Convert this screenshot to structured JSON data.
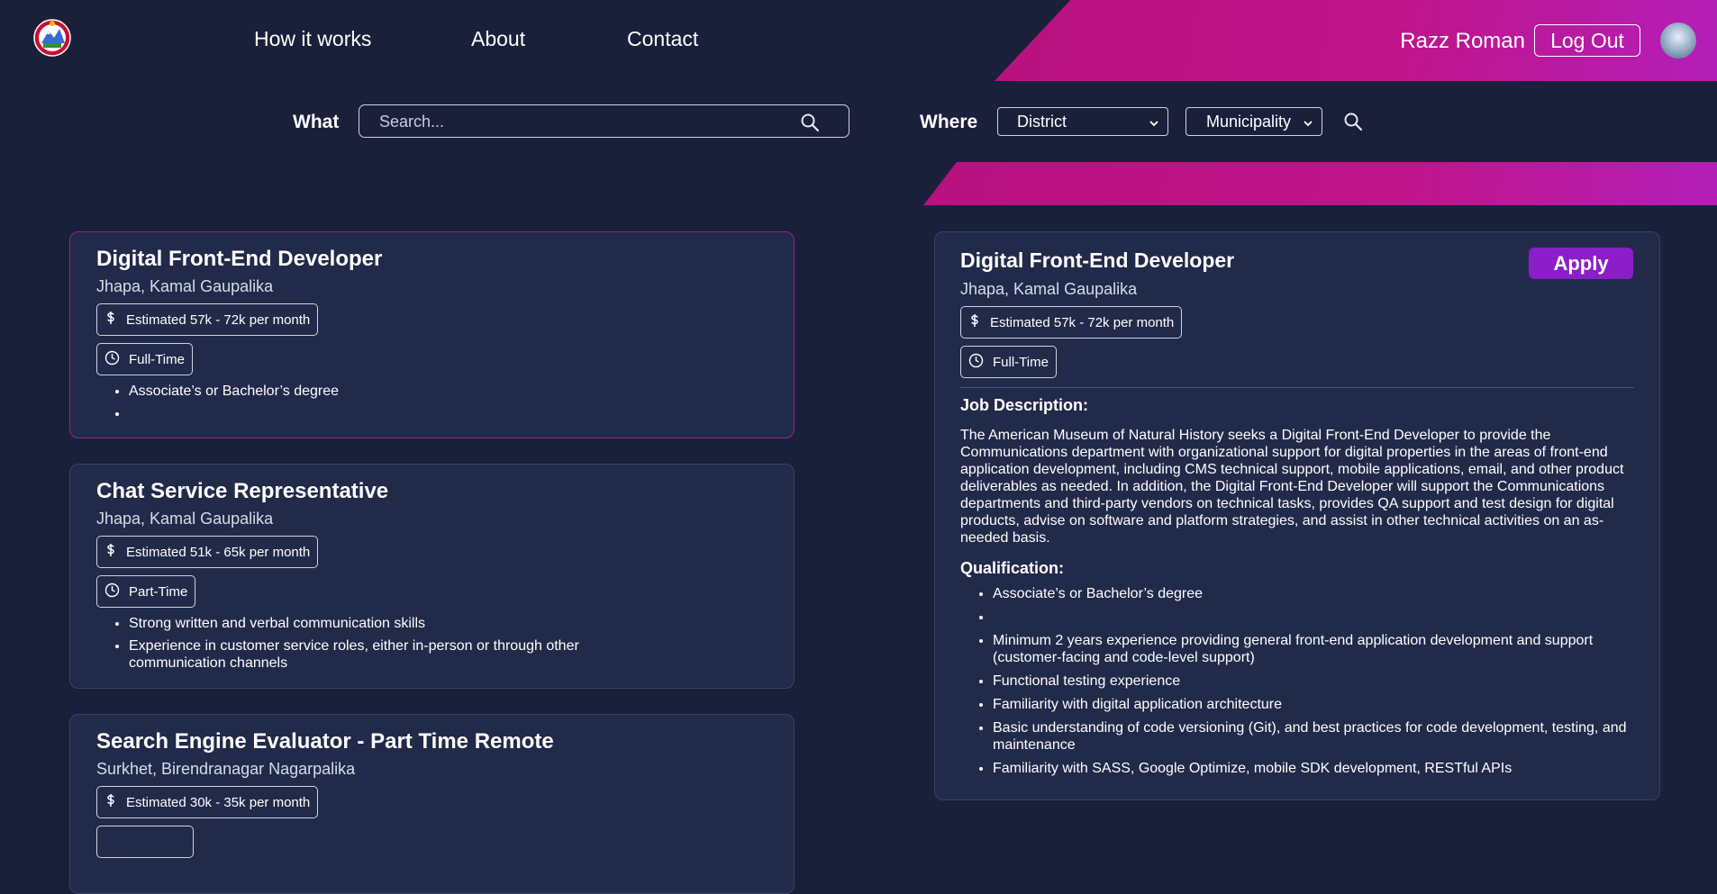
{
  "header": {
    "nav": [
      "How it works",
      "About",
      "Contact"
    ],
    "user_name": "Razz Roman",
    "logout_label": "Log Out"
  },
  "search": {
    "what_label": "What",
    "placeholder": "Search...",
    "where_label": "Where",
    "district": "District",
    "municipality": "Municipality"
  },
  "jobs": [
    {
      "title": "Digital Front-End Developer",
      "location": "Jhapa, Kamal Gaupalika",
      "salary": "Estimated 57k - 72k per month",
      "type": "Full-Time",
      "quals": [
        "Associate’s or Bachelor’s degree",
        ""
      ]
    },
    {
      "title": "Chat Service Representative",
      "location": "Jhapa, Kamal Gaupalika",
      "salary": "Estimated 51k - 65k per month",
      "type": "Part-Time",
      "quals": [
        "Strong written and verbal communication skills",
        "Experience in customer service roles, either in-person or through other communication channels"
      ]
    },
    {
      "title": "Search Engine Evaluator - Part Time Remote",
      "location": "Surkhet, Birendranagar Nagarpalika",
      "salary": "Estimated 30k - 35k per month"
    }
  ],
  "detail": {
    "title": "Digital Front-End Developer",
    "apply_label": "Apply",
    "location": "Jhapa, Kamal Gaupalika",
    "salary": "Estimated 57k - 72k per month",
    "type": "Full-Time",
    "desc_heading": "Job Description:",
    "description": "The American Museum of Natural History seeks a Digital Front-End Developer to provide the Communications department with organizational support for digital properties in the areas of front-end application development, including CMS technical support, mobile applications, email, and other product deliverables as needed. In addition, the Digital Front-End Developer will support the Communications departments and third-party vendors on technical tasks, provides QA support and test design for digital products, advise on software and platform strategies, and assist in other technical activities on an as-needed basis.",
    "qual_heading": "Qualification:",
    "quals": [
      "Associate’s or Bachelor’s degree",
      "",
      "Minimum 2 years experience providing general front-end application development and support (customer-facing and code-level support)",
      "Functional testing experience",
      "Familiarity with digital application architecture",
      "Basic understanding of code versioning (Git), and best practices for code development, testing, and maintenance",
      "Familiarity with SASS, Google Optimize, mobile SDK development, RESTful APIs"
    ]
  }
}
